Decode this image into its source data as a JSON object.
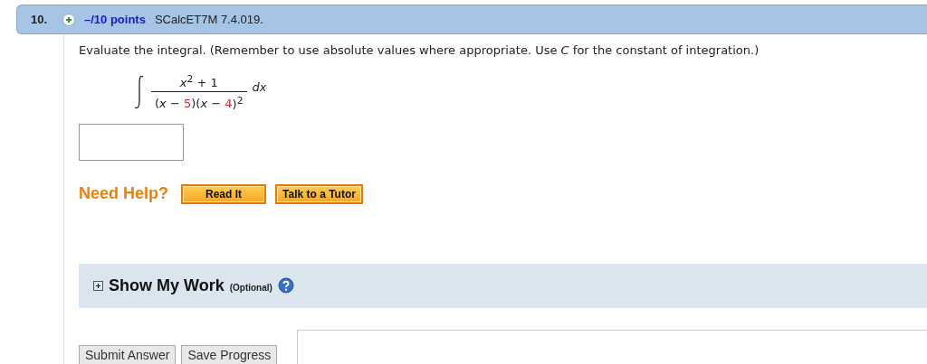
{
  "question": {
    "number": "10.",
    "expanded": false,
    "points": "–/10 points",
    "source": "SCalcET7M 7.4.019."
  },
  "prompt": "Evaluate the integral. (Remember to use absolute values where appropriate. Use *C* for the constant of integration.)",
  "integral": {
    "numerator": [
      {
        "text": "*x*$^{2}$ + 1",
        "color": "#222222"
      }
    ],
    "denominator": [
      {
        "text": "(*x* − ",
        "color": "#222222"
      },
      {
        "text": "5",
        "color": "#e02020"
      },
      {
        "text": ")(*x* − ",
        "color": "#222222"
      },
      {
        "text": "4",
        "color": "#e02020"
      },
      {
        "text": ")$^{2}$",
        "color": "#222222"
      }
    ],
    "differential": "*dx*"
  },
  "help": {
    "label": "Need Help?",
    "buttons": [
      "Read It",
      "Talk to a Tutor"
    ]
  },
  "show_my_work": {
    "title": "Show My Work",
    "note": "(Optional)",
    "expanded": false
  },
  "actions": [
    "Submit Answer",
    "Save Progress"
  ]
}
